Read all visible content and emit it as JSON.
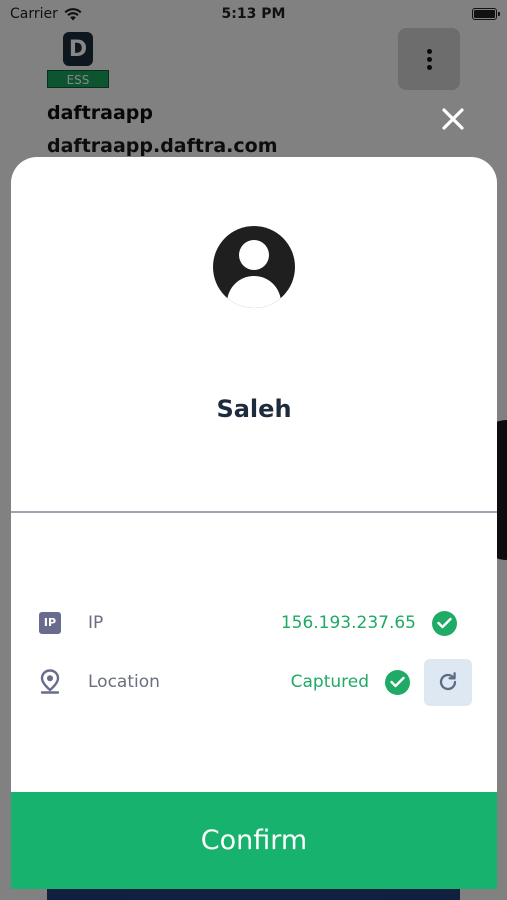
{
  "status_bar": {
    "carrier": "Carrier",
    "time": "5:13 PM"
  },
  "app": {
    "logo_letter": "D",
    "logo_badge": "ESS",
    "company_name": "daftraapp",
    "company_url": "daftraapp.daftra.com"
  },
  "modal": {
    "user_name": "Saleh",
    "ip": {
      "icon_text": "IP",
      "label": "IP",
      "value": "156.193.237.65"
    },
    "location": {
      "label": "Location",
      "value": "Captured"
    },
    "confirm_label": "Confirm"
  },
  "colors": {
    "accent_green": "#17b26e",
    "value_green": "#1faa66",
    "title_navy": "#1d2b3c"
  },
  "icons": {
    "wifi": "wifi-icon",
    "battery": "battery-icon",
    "menu": "more-vertical-icon",
    "close": "close-icon",
    "avatar": "user-avatar-icon",
    "ip": "ip-icon",
    "location": "location-pin-icon",
    "check": "check-circle-icon",
    "refresh": "refresh-icon"
  }
}
